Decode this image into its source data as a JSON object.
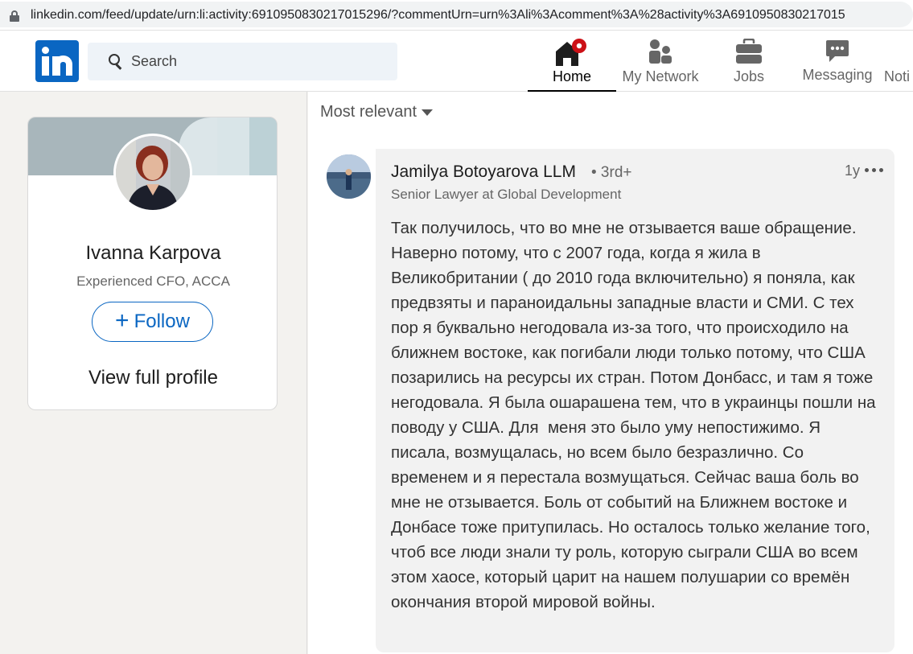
{
  "browser": {
    "url": "linkedin.com/feed/update/urn:li:activity:6910950830217015296/?commentUrn=urn%3Ali%3Acomment%3A%28activity%3A6910950830217015"
  },
  "nav": {
    "search_placeholder": "Search",
    "items": [
      {
        "label": "Home",
        "icon": "home-icon",
        "active": true,
        "badge_color": "#cc1016"
      },
      {
        "label": "My Network",
        "icon": "people-icon"
      },
      {
        "label": "Jobs",
        "icon": "briefcase-icon"
      },
      {
        "label": "Messaging",
        "icon": "chat-icon"
      },
      {
        "label": "Noti",
        "icon": "bell-icon"
      }
    ]
  },
  "profile_card": {
    "name": "Ivanna Karpova",
    "headline": "Experienced CFO, ACCA",
    "follow_label": "Follow",
    "view_profile_label": "View full profile"
  },
  "feed": {
    "sort_label": "Most relevant",
    "comment": {
      "author": "Jamilya Botoyarova LLM",
      "degree": "• 3rd+",
      "headline": "Senior Lawyer at Global Development",
      "time": "1y",
      "text": "Так получилось, что во мне не отзывается ваше обращение. Наверно потому, что с 2007 года, когда я жила в Великобритании ( до 2010 года включительно) я поняла, как предвзяты и параноидальны западные власти и СМИ. С тех пор я буквально негодовала из-за того, что происходило на ближнем востоке, как погибали люди только потому, что США позарились на ресурсы их стран. Потом Донбасс, и там я тоже негодовала. Я была ошарашена тем, что в украинцы пошли на поводу у США. Для  меня это было уму непостижимо. Я писала, возмущалась, но всем было безразлично. Со временем и я перестала возмущаться. Сейчас ваша боль во мне не отзывается. Боль от событий на Ближнем востоке и Донбасе тоже притупилась. Но осталось только желание того, чтоб все люди знали ту роль, которую сыграли США во всем этом хаосе, который царит на нашем полушарии со времён окончания второй мировой войны."
    }
  },
  "colors": {
    "brand": "#0a66c2",
    "background": "#f3f2ef",
    "bubble": "#f2f2f2"
  }
}
